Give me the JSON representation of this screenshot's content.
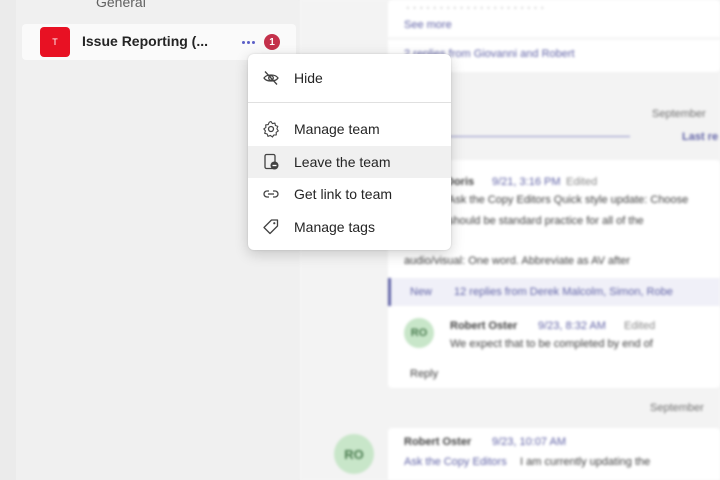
{
  "sidebar": {
    "channel_general": "General",
    "team": {
      "avatar_letter": "T",
      "name": "Issue Reporting (...",
      "badge_count": "1",
      "avatar_color": "#e81123",
      "badge_color": "#c4314b"
    }
  },
  "context_menu": {
    "items": [
      {
        "label": "Hide",
        "icon": "eye-off-icon"
      },
      {
        "label": "Manage team",
        "icon": "gear-icon"
      },
      {
        "label": "Leave the team",
        "icon": "leave-team-icon"
      },
      {
        "label": "Get link to team",
        "icon": "link-icon"
      },
      {
        "label": "Manage tags",
        "icon": "tag-icon"
      }
    ],
    "hovered_item": "Leave the team"
  },
  "conversation": {
    "see_more": "See more",
    "replies_1": "2 replies from Giovanni and Robert",
    "reply_label": "Reply",
    "date_1": "September",
    "last_read": "Last re",
    "msg1_author": "Doris",
    "msg1_time": "9/21, 3:16 PM",
    "msg1_edited": "Edited",
    "msg1_line1": "Ask the Copy Editors Quick style update: Choose",
    "msg1_line2": "should be standard practice for all of the",
    "msg2_text": "audio/visual: One word. Abbreviate as AV after",
    "new_label": "New",
    "replies_2": "12 replies from Derek Malcolm, Simon, Robe",
    "msg3_author": "Robert Oster",
    "msg3_time": "9/23, 8:32 AM",
    "msg3_edited": "Edited",
    "msg3_text": "We expect that to be completed by end of",
    "date_2": "September",
    "msg4_author": "Robert Oster",
    "msg4_time": "9/23, 10:07 AM",
    "msg4_text_link": "Ask the Copy Editors",
    "msg4_text": "I am currently updating the",
    "avatar_initials": "RO",
    "accent_color": "#6264a7"
  }
}
